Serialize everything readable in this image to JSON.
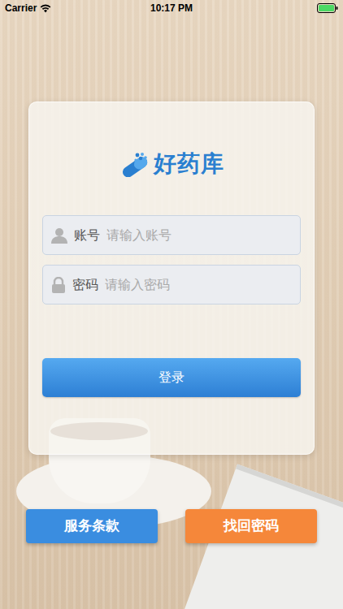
{
  "status_bar": {
    "carrier": "Carrier",
    "time": "10:17 PM"
  },
  "logo": {
    "text": "好药库"
  },
  "fields": [
    {
      "kind": "account",
      "label": "账号",
      "placeholder": "请输入账号"
    },
    {
      "kind": "password",
      "label": "密码",
      "placeholder": "请输入密码"
    }
  ],
  "login_button": "登录",
  "bottom_buttons": [
    {
      "label": "服务条款",
      "color": "#3a8de0"
    },
    {
      "label": "找回密码",
      "color": "#f5873a"
    }
  ]
}
